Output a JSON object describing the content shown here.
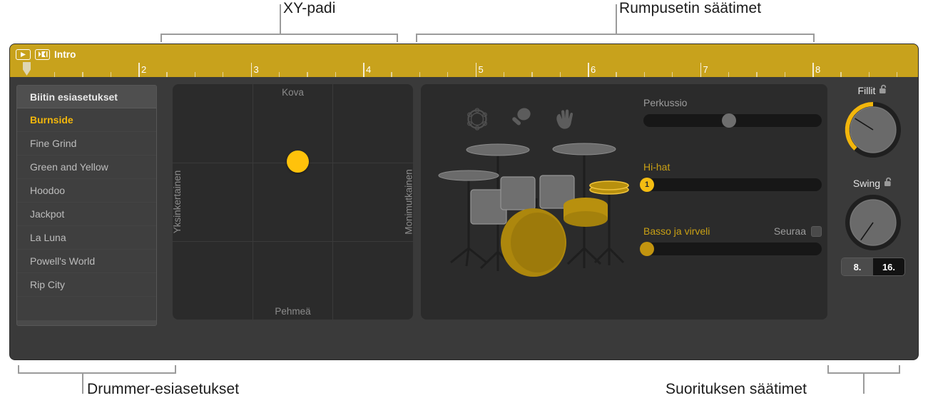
{
  "annotations": {
    "top_left": "XY-padi",
    "top_right": "Rumpusetin säätimet",
    "bottom_left": "Drummer-esiasetukset",
    "bottom_right": "Suorituksen säätimet"
  },
  "ruler": {
    "region_name": "Intro",
    "play_icon": "play-icon",
    "mute_icon": "region-filter-icon",
    "bars": [
      "2",
      "3",
      "4",
      "5",
      "6",
      "7",
      "8"
    ],
    "color": "#c8a21c"
  },
  "presets": {
    "header": "Biitin esiasetukset",
    "items": [
      {
        "label": "Burnside",
        "selected": true
      },
      {
        "label": "Fine Grind",
        "selected": false
      },
      {
        "label": "Green and Yellow",
        "selected": false
      },
      {
        "label": "Hoodoo",
        "selected": false
      },
      {
        "label": "Jackpot",
        "selected": false
      },
      {
        "label": "La Luna",
        "selected": false
      },
      {
        "label": "Powell's World",
        "selected": false
      },
      {
        "label": "Rip City",
        "selected": false
      }
    ]
  },
  "xy_pad": {
    "top_label": "Kova",
    "bottom_label": "Pehmeä",
    "left_label": "Yksinkertainen",
    "right_label": "Monimutkainen",
    "puck_x_percent": 52,
    "puck_y_percent": 33,
    "puck_color": "#ffc20b"
  },
  "kit": {
    "percussion_icons": [
      {
        "name": "tambourine-icon",
        "active": false
      },
      {
        "name": "shaker-icon",
        "active": true
      },
      {
        "name": "hand-clap-icon",
        "active": true
      }
    ],
    "sliders": [
      {
        "name": "Perkussio",
        "active": false,
        "value_percent": 48,
        "handle": "grey",
        "badge": ""
      },
      {
        "name": "Hi-hat",
        "active": true,
        "value_percent": 2,
        "handle": "yellow",
        "badge": "1"
      },
      {
        "name": "Basso ja virveli",
        "active": true,
        "value_percent": 2,
        "handle": "gold",
        "badge": ""
      }
    ],
    "follow": {
      "label": "Seuraa",
      "checked": false
    }
  },
  "performance": {
    "fills": {
      "label": "Fillit",
      "lock_icon": "unlocked-padlock-icon",
      "angle_deg": -58,
      "arc_color": "#f2b60c"
    },
    "swing": {
      "label": "Swing",
      "lock_icon": "unlocked-padlock-icon",
      "angle_deg": -145
    },
    "division": {
      "options": [
        "8.",
        "16."
      ],
      "selected": "16."
    }
  },
  "colors": {
    "accent": "#f2b60c",
    "ruler": "#c8a21c",
    "window_bg": "#3a3a3a",
    "panel_bg": "#2b2b2b"
  }
}
